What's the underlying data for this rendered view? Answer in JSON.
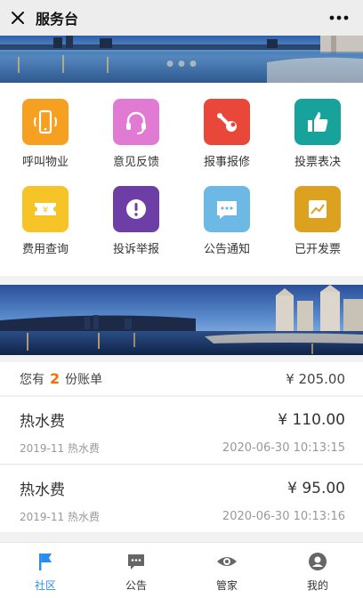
{
  "header": {
    "title": "服务台"
  },
  "services": [
    {
      "label": "呼叫物业",
      "icon": "phone-icon",
      "color": "#f5a020"
    },
    {
      "label": "意见反馈",
      "icon": "headset-icon",
      "color": "#e07ad2"
    },
    {
      "label": "报事报修",
      "icon": "wrench-icon",
      "color": "#e8473a"
    },
    {
      "label": "投票表决",
      "icon": "thumbs-up-icon",
      "color": "#17a39b"
    },
    {
      "label": "费用查询",
      "icon": "ticket-yen-icon",
      "color": "#f6c427"
    },
    {
      "label": "投诉举报",
      "icon": "exclamation-icon",
      "color": "#6e3ea7"
    },
    {
      "label": "公告通知",
      "icon": "chat-bubble-icon",
      "color": "#6cb9e6"
    },
    {
      "label": "已开发票",
      "icon": "invoice-chart-icon",
      "color": "#dca11f"
    }
  ],
  "summary": {
    "prefix": "您有",
    "count": "2",
    "suffix": "份账单",
    "total": "¥ 205.00"
  },
  "bills": [
    {
      "name": "热水费",
      "amount": "¥ 110.00",
      "subtitle": "2019-11 热水费",
      "time": "2020-06-30 10:13:15"
    },
    {
      "name": "热水费",
      "amount": "¥ 95.00",
      "subtitle": "2019-11 热水费",
      "time": "2020-06-30 10:13:16"
    }
  ],
  "tabs": [
    {
      "label": "社区",
      "icon": "flag-icon",
      "active": true
    },
    {
      "label": "公告",
      "icon": "message-icon"
    },
    {
      "label": "管家",
      "icon": "eye-icon"
    },
    {
      "label": "我的",
      "icon": "user-icon"
    }
  ],
  "colors": {
    "accent": "#2b8cf0",
    "highlight": "#ff6a00"
  }
}
